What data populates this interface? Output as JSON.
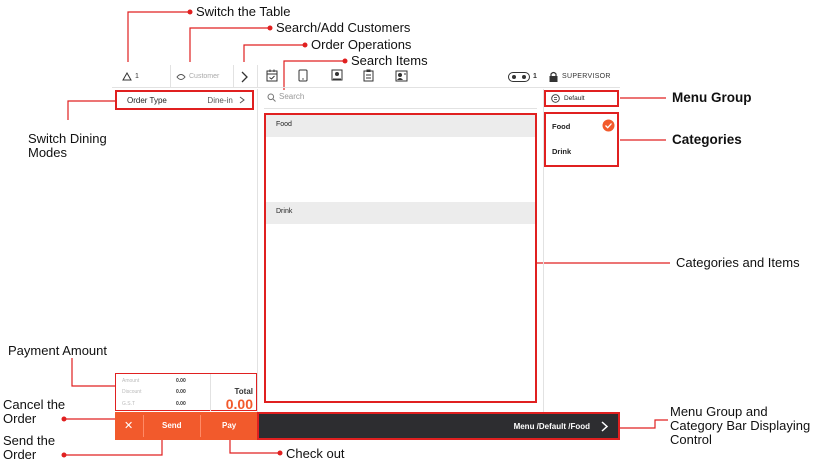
{
  "annotations": {
    "switch_table": "Switch the Table",
    "search_customers": "Search/Add Customers",
    "order_operations": "Order Operations",
    "search_items": "Search Items",
    "menu_group": "Menu Group",
    "categories": "Categories",
    "switch_dining": "Switch Dining Modes",
    "categories_items": "Categories and Items",
    "payment_amount": "Payment Amount",
    "cancel_order": "Cancel the Order",
    "send_order": "Send the Order",
    "check_out": "Check out",
    "menu_bar_control": "Menu Group and Category Bar Displaying Control"
  },
  "topbar": {
    "table_number": "1",
    "customer_placeholder": "Customer",
    "desk_count": "1",
    "role": "SUPERVISOR"
  },
  "order": {
    "type_label": "Order Type",
    "type_value": "Dine-in"
  },
  "search": {
    "placeholder": "Search"
  },
  "menu_group": {
    "name": "Default"
  },
  "categories": [
    {
      "label": "Food",
      "selected": true
    },
    {
      "label": "Drink",
      "selected": false
    }
  ],
  "items_panel": {
    "sections": [
      "Food",
      "Drink"
    ]
  },
  "payment": {
    "amount_label": "Amount",
    "amount_value": "0.00",
    "discount_label": "Discount",
    "discount_value": "0.00",
    "gst_label": "G.S.T",
    "gst_value": "0.00",
    "total_label": "Total",
    "total_value": "0.00"
  },
  "buttons": {
    "cancel": "✕",
    "send": "Send",
    "pay": "Pay"
  },
  "bottom_bar": {
    "breadcrumb": "Menu /Default /Food"
  },
  "colors": {
    "accent": "#f25a2c",
    "highlight": "#e02020",
    "bar": "#2d2d30"
  }
}
